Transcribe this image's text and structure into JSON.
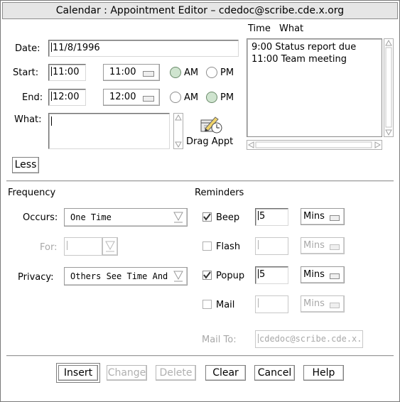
{
  "window": {
    "title": "Calendar : Appointment Editor – cdedoc@scribe.cde.x.org"
  },
  "appt": {
    "date_label": "Date:",
    "date_value": "11/8/1996",
    "start_label": "Start:",
    "start_value": "11:00",
    "start_combo": "11:00",
    "end_label": "End:",
    "end_value": "12:00",
    "end_combo": "12:00",
    "am_label": "AM",
    "pm_label": "PM",
    "start_meridiem": "AM",
    "end_meridiem": "PM",
    "what_label": "What:",
    "what_value": "",
    "drag_label": "Drag Appt",
    "less_label": "Less"
  },
  "list": {
    "time_header": "Time",
    "what_header": "What",
    "items": [
      {
        "text": "9:00 Status report due"
      },
      {
        "text": "11:00 Team meeting"
      }
    ]
  },
  "frequency": {
    "header": "Frequency",
    "occurs_label": "Occurs:",
    "occurs_value": "One Time",
    "for_label": "For:",
    "for_value": "",
    "privacy_label": "Privacy:",
    "privacy_value": "Others See Time And"
  },
  "reminders": {
    "header": "Reminders",
    "items": [
      {
        "label": "Beep",
        "checked": true,
        "value": "5",
        "unit": "Mins",
        "enabled": true
      },
      {
        "label": "Flash",
        "checked": false,
        "value": "",
        "unit": "Mins",
        "enabled": false
      },
      {
        "label": "Popup",
        "checked": true,
        "value": "5",
        "unit": "Mins",
        "enabled": true
      },
      {
        "label": "Mail",
        "checked": false,
        "value": "",
        "unit": "Mins",
        "enabled": false
      }
    ],
    "mailto_label": "Mail To:",
    "mailto_value": "cdedoc@scribe.cde.x."
  },
  "buttons": {
    "insert": "Insert",
    "change": "Change",
    "delete": "Delete",
    "clear": "Clear",
    "cancel": "Cancel",
    "help": "Help"
  },
  "colors": {
    "selected_radio": "#cfe4cf",
    "disabled_text": "#a8a8a8",
    "title_bg": "#e6e6e6"
  }
}
